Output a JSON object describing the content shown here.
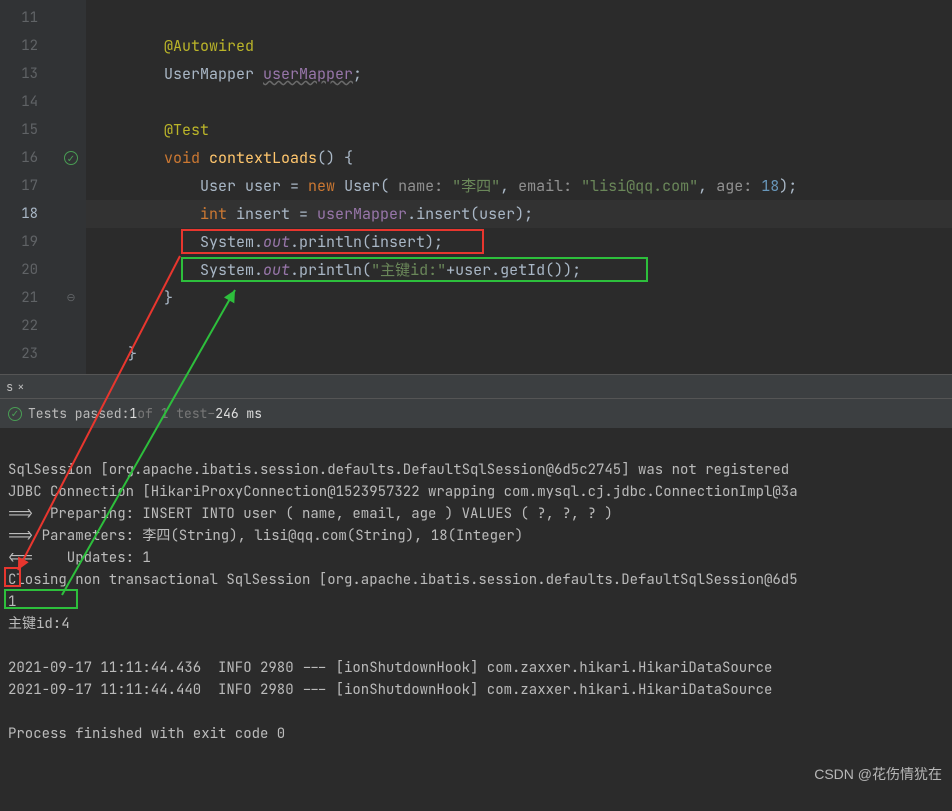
{
  "editor": {
    "lines": {
      "l11": "11",
      "l12": "12",
      "l13": "13",
      "l14": "14",
      "l15": "15",
      "l16": "16",
      "l17": "17",
      "l18": "18",
      "l19": "19",
      "l20": "20",
      "l21": "21",
      "l22": "22",
      "l23": "23"
    },
    "code": {
      "autowired": "@Autowired",
      "userMapperType": "UserMapper ",
      "userMapperField": "userMapper",
      "semi": ";",
      "testAnn": "@Test",
      "void": "void ",
      "contextLoads": "contextLoads",
      "parenBrace": "() {",
      "userType": "User ",
      "userVar": "user = ",
      "new": "new ",
      "userCtor": "User",
      "paren": "( ",
      "pName": "name: ",
      "sName": "\"李四\"",
      "comma1": ", ",
      "pEmail": "email: ",
      "sEmail": "\"lisi@qq.com\"",
      "comma2": ", ",
      "pAge": "age: ",
      "nAge": "18",
      "close1": ");",
      "intType": "int ",
      "insertVar": "insert = ",
      "userMapperRef": "userMapper",
      "dotInsert": ".insert(user);",
      "system1": "System.",
      "out1": "out",
      "println1": ".println(insert);",
      "system2": "System.",
      "out2": "out",
      "println2a": ".println(",
      "sPrefix": "\"主键id:\"",
      "plus": "+user.getId());",
      "closeBrace1": "}",
      "closeBrace2": "}"
    }
  },
  "status": {
    "passed": "Tests passed: ",
    "one": "1",
    "ofTests": " of 1 test",
    "dash": " – ",
    "time": "246 ms"
  },
  "console": {
    "l1": "SqlSession [org.apache.ibatis.session.defaults.DefaultSqlSession@6d5c2745] was not registered ",
    "l2": "JDBC Connection [HikariProxyConnection@1523957322 wrapping com.mysql.cj.jdbc.ConnectionImpl@3a",
    "l3": "==>  Preparing: INSERT INTO user ( name, email, age ) VALUES ( ?, ?, ? )",
    "l4": "==> Parameters: 李四(String), lisi@qq.com(String), 18(Integer)",
    "l5": "<==    Updates: 1",
    "l6": "Closing non transactional SqlSession [org.apache.ibatis.session.defaults.DefaultSqlSession@6d5",
    "l7": "1",
    "l8": "主键id:4",
    "l9": "",
    "l10": "2021-09-17 11:11:44.436  INFO 2980 --- [ionShutdownHook] com.zaxxer.hikari.HikariDataSource",
    "l11": "2021-09-17 11:11:44.440  INFO 2980 --- [ionShutdownHook] com.zaxxer.hikari.HikariDataSource",
    "l12": "",
    "l13": "Process finished with exit code 0"
  },
  "watermark": "CSDN @花伤情犹在",
  "tab": {
    "close": "×"
  }
}
